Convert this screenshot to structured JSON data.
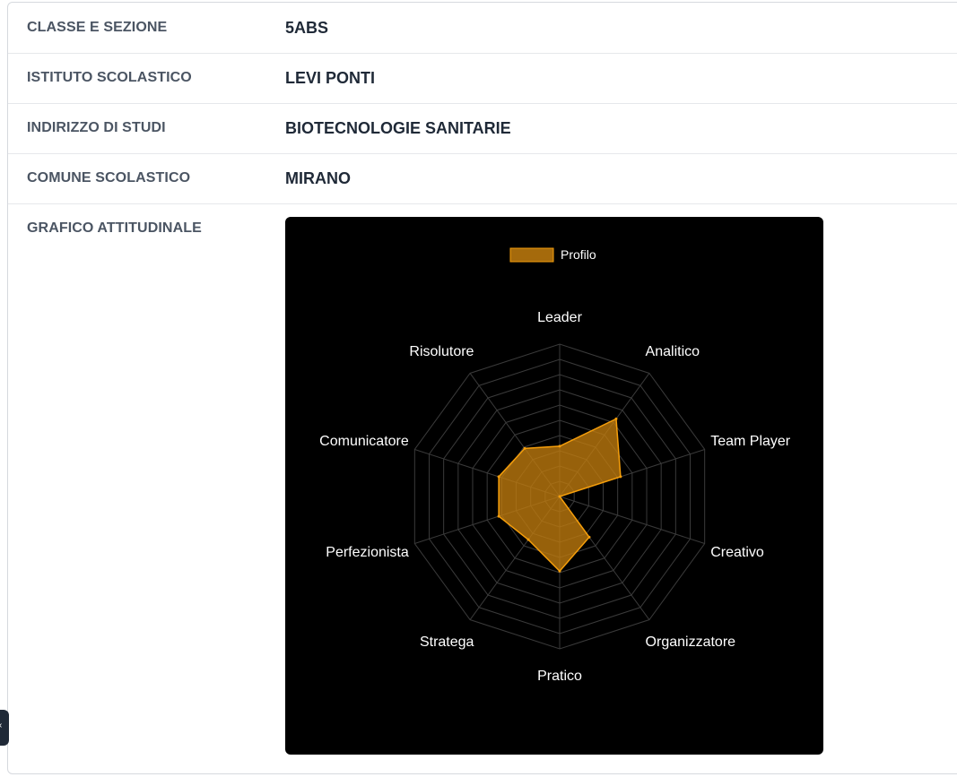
{
  "rows": [
    {
      "label": "CLASSE E SEZIONE",
      "value": "5ABS"
    },
    {
      "label": "ISTITUTO SCOLASTICO",
      "value": "LEVI PONTI"
    },
    {
      "label": "INDIRIZZO DI STUDI",
      "value": "BIOTECNOLOGIE SANITARIE"
    },
    {
      "label": "COMUNE SCOLASTICO",
      "value": "MIRANO"
    },
    {
      "label": "GRAFICO ATTITUDINALE",
      "value": ""
    }
  ],
  "side_tab_glyph": "‹",
  "chart_data": {
    "type": "radar",
    "title": "",
    "categories": [
      "Leader",
      "Analitico",
      "Team Player",
      "Creativo",
      "Organizzatore",
      "Pratico",
      "Stratega",
      "Perfezionista",
      "Comunicatore",
      "Risolutore"
    ],
    "series": [
      {
        "name": "Profilo",
        "values": [
          3.3,
          6.3,
          4.2,
          0,
          3.3,
          4.9,
          3.5,
          4.2,
          4.2,
          3.9
        ]
      }
    ],
    "rlim": [
      0,
      10
    ],
    "grid_levels": 10,
    "grid": true,
    "legend_position": "top",
    "colors": {
      "background": "#000000",
      "grid": "#3a3a3a",
      "fill": "#c27c0e",
      "fill_opacity": 0.78,
      "stroke": "#f59e0b",
      "label": "#ffffff"
    }
  }
}
